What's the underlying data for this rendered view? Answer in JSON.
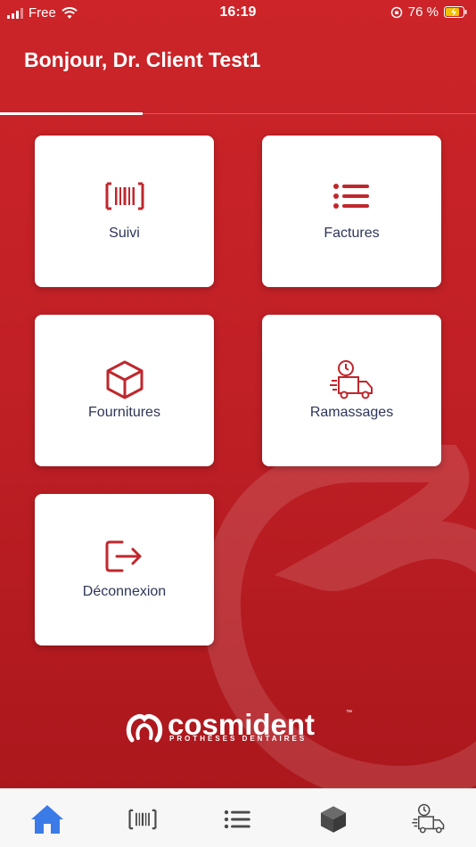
{
  "status_bar": {
    "carrier": "Free",
    "time": "16:19",
    "battery_percent": "76 %"
  },
  "header": {
    "greeting": "Bonjour, Dr. Client Test1"
  },
  "tabs": {
    "active_index": 0
  },
  "menu": {
    "suivi": {
      "label": "Suivi",
      "icon": "barcode-icon"
    },
    "factures": {
      "label": "Factures",
      "icon": "list-icon"
    },
    "fournitures": {
      "label": "Fournitures",
      "icon": "box-icon"
    },
    "ramassages": {
      "label": "Ramassages",
      "icon": "delivery-truck-icon"
    },
    "deconnexion": {
      "label": "Déconnexion",
      "icon": "logout-icon"
    }
  },
  "brand": {
    "name": "cosmident",
    "trademark": "™",
    "tagline": "PROTHÈSES DENTAIRES"
  },
  "bottom_nav": {
    "items": [
      {
        "name": "home",
        "icon": "home-icon",
        "active": true
      },
      {
        "name": "suivi",
        "icon": "barcode-icon",
        "active": false
      },
      {
        "name": "factures",
        "icon": "list-icon",
        "active": false
      },
      {
        "name": "fournitures",
        "icon": "box-icon",
        "active": false
      },
      {
        "name": "ramassages",
        "icon": "delivery-truck-icon",
        "active": false
      }
    ]
  },
  "colors": {
    "primary_red": "#c62226",
    "icon_red": "#c0272d",
    "label_navy": "#2e3558",
    "nav_active": "#3b7be8",
    "nav_inactive": "#4a4a4a"
  }
}
